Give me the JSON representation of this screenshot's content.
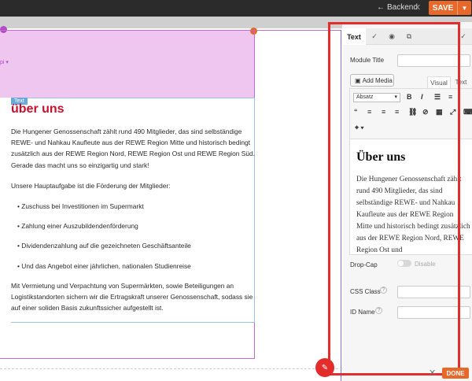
{
  "topbar": {
    "back_label": "Backend",
    "save_label": "SAVE"
  },
  "canvas": {
    "module_tag": "Text",
    "heading": "über uns",
    "paragraph1": "Die Hungener Genossenschaft zählt rund 490 Mitglieder, das sind selbständige REWE- und Nahkau Kaufleute aus der REWE Region Mitte und historisch bedingt zusätzlich aus der REWE Region Nord, REWE Region Ost und REWE Region Süd. Gerade das macht uns so einzigartig und stark!",
    "paragraph2": "Unsere Hauptaufgabe ist die Förderung der Mitglieder:",
    "bullets": [
      "Zuschuss bei Investitionen im Supermarkt",
      "Zahlung einer Auszubildendenförderung",
      "Dividendenzahlung auf die gezeichneten Geschäftsanteile",
      "Und das Angebot einer jährlichen, nationalen Studienreise"
    ],
    "paragraph3": "Mit Vermietung und Verpachtung von Supermärkten, sowie Beteiligungen an Logistikstandorten sichern wir die Ertragskraft unserer Genossenschaft, sodass sie auf einer soliden Basis zukunftssicher aufgestellt ist."
  },
  "panel": {
    "tab_text": "Text",
    "module_title_label": "Module Title",
    "add_media_label": "Add Media",
    "visual_tab": "Visual",
    "text_tab": "Text",
    "format_select": "Absatz",
    "editor_heading": "Über uns",
    "editor_body": "Die Hungener Genossenschaft zählt rund 490 Mitglieder, das sind selbständige REWE- und Nahkau Kaufleute aus der REWE Region Mitte und historisch bedingt zusätzlich aus der REWE Region Nord, REWE Region Ost und",
    "dropcap_label": "Drop-Cap",
    "dropcap_state": "Disable",
    "css_class_label": "CSS Class",
    "id_name_label": "ID Name",
    "done_label": "DONE"
  }
}
